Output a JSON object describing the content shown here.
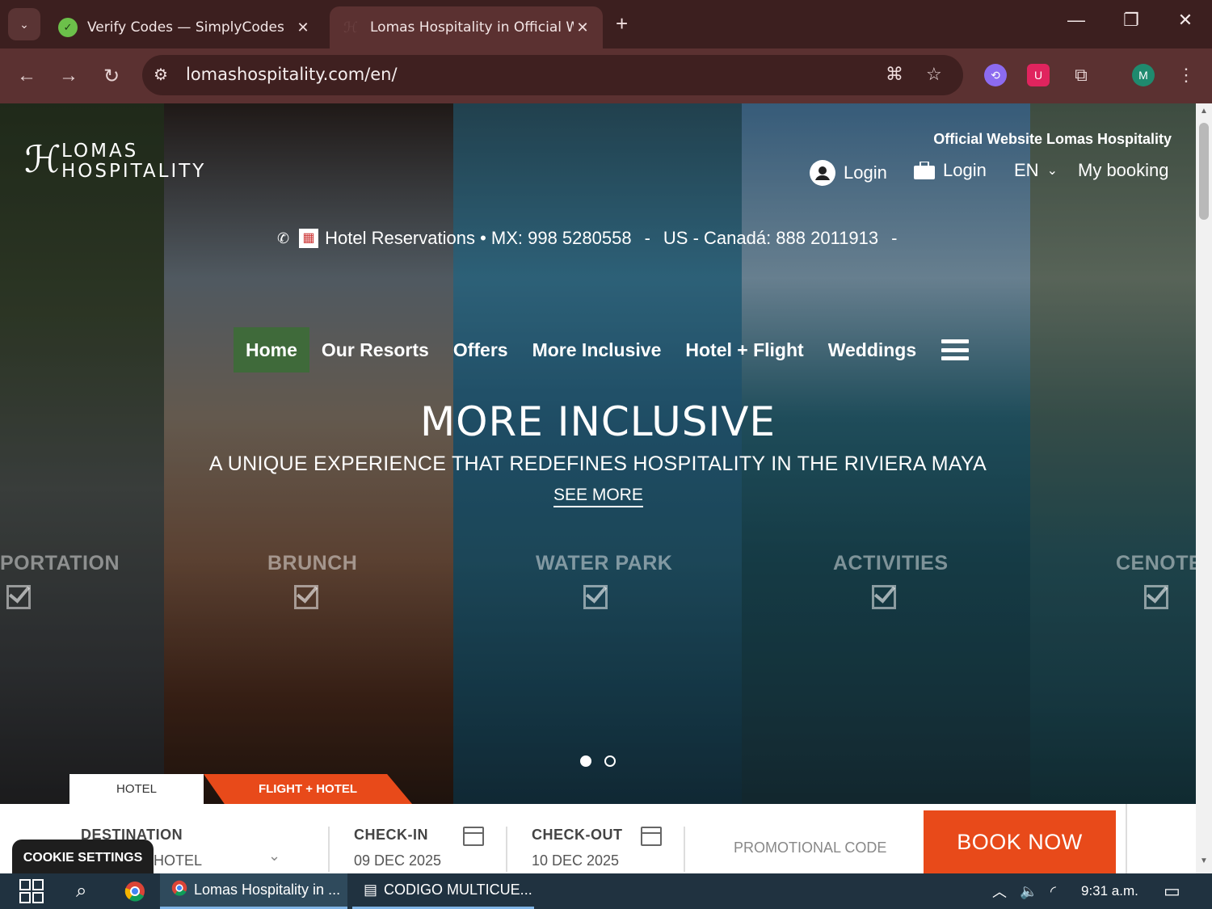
{
  "browser": {
    "tabs": [
      {
        "title": "Verify Codes — SimplyCodes",
        "active": false
      },
      {
        "title": "Lomas Hospitality in Official We",
        "active": true
      }
    ],
    "url": "lomashospitality.com/en/",
    "profile_initial": "M"
  },
  "site": {
    "logo_line1": "LOMAS",
    "logo_line2": "HOSPITALITY",
    "official_text": "Official Website Lomas Hospitality",
    "top_links": {
      "login1": "Login",
      "login2": "Login",
      "language": "EN",
      "my_booking": "My booking"
    },
    "phone_bar": {
      "reservations": "Hotel Reservations • MX: 998 5280558",
      "sep1": "-",
      "us_canada": "US - Canadá: 888 2011913",
      "sep2": "-"
    },
    "menu": [
      "Home",
      "Our Resorts",
      "Offers",
      "More Inclusive",
      "Hotel + Flight",
      "Weddings"
    ],
    "hero": {
      "title": "MORE INCLUSIVE",
      "subtitle": "A UNIQUE EXPERIENCE THAT REDEFINES HOSPITALITY IN THE RIVIERA MAYA",
      "link": "SEE MORE"
    },
    "categories": [
      "PORTATION",
      "BRUNCH",
      "WATER PARK",
      "ACTIVITIES",
      "CENOTE"
    ],
    "slider_dots": 2,
    "slider_active": 1,
    "booking": {
      "tabs": [
        "HOTEL",
        "FLIGHT + HOTEL"
      ],
      "destination_label": "DESTINATION",
      "destination_value": "HOTEL",
      "checkin_label": "CHECK-IN",
      "checkin_value": "09 DEC 2025",
      "checkout_label": "CHECK-OUT",
      "checkout_value": "10 DEC 2025",
      "promo_placeholder": "PROMOTIONAL CODE",
      "book_button": "BOOK NOW"
    },
    "cookie_button": "COOKIE SETTINGS"
  },
  "taskbar": {
    "apps": [
      "Lomas Hospitality in ...",
      "CODIGO MULTICUE..."
    ],
    "time": "9:31 a.m."
  },
  "colors": {
    "accent": "#e84a1a",
    "menu_active": "#3f6a3a",
    "browser_frame": "#5b3131"
  }
}
